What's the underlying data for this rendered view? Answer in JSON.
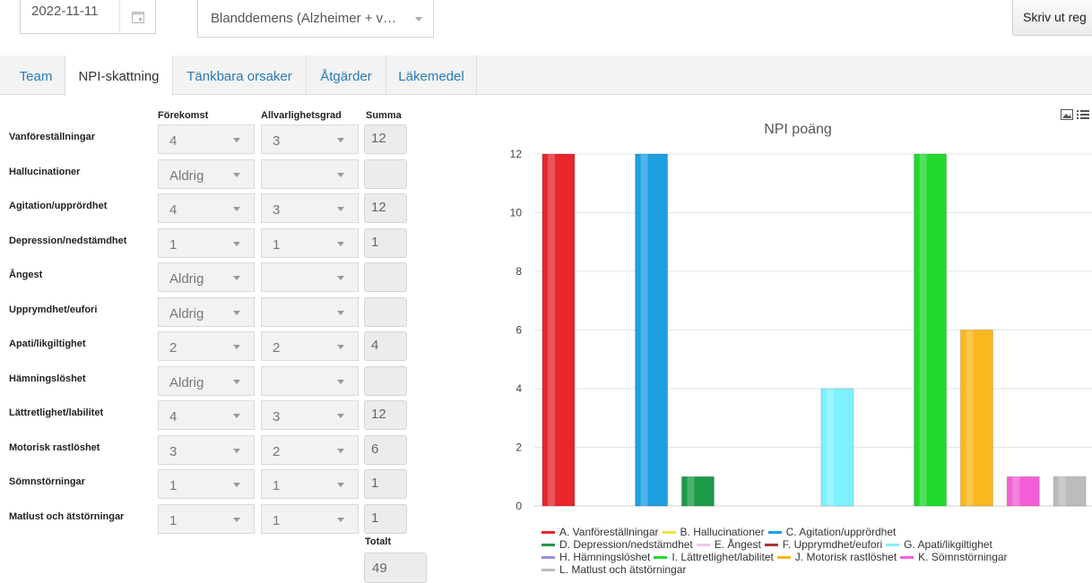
{
  "header": {
    "date_value": "2022-11-11",
    "diagnosis_value": "Blanddemens (Alzheimer + v…",
    "print_label": "Skriv ut reg"
  },
  "tabs": [
    {
      "label": "Team",
      "active": false
    },
    {
      "label": "NPI-skattning",
      "active": true
    },
    {
      "label": "Tänkbara orsaker",
      "active": false
    },
    {
      "label": "Åtgärder",
      "active": false
    },
    {
      "label": "Läkemedel",
      "active": false
    }
  ],
  "grid": {
    "col_frequency": "Förekomst",
    "col_severity": "Allvarlighetsgrad",
    "col_sum": "Summa",
    "total_label": "Totalt",
    "total_value": "49",
    "rows": [
      {
        "label": "Vanföreställningar",
        "frequency": "4",
        "severity": "3",
        "sum": "12"
      },
      {
        "label": "Hallucinationer",
        "frequency": "Aldrig",
        "severity": "",
        "sum": ""
      },
      {
        "label": "Agitation/upprördhet",
        "frequency": "4",
        "severity": "3",
        "sum": "12"
      },
      {
        "label": "Depression/nedstämdhet",
        "frequency": "1",
        "severity": "1",
        "sum": "1"
      },
      {
        "label": "Ångest",
        "frequency": "Aldrig",
        "severity": "",
        "sum": ""
      },
      {
        "label": "Upprymdhet/eufori",
        "frequency": "Aldrig",
        "severity": "",
        "sum": ""
      },
      {
        "label": "Apati/likgiltighet",
        "frequency": "2",
        "severity": "2",
        "sum": "4"
      },
      {
        "label": "Hämningslöshet",
        "frequency": "Aldrig",
        "severity": "",
        "sum": ""
      },
      {
        "label": "Lättretlighet/labilitet",
        "frequency": "4",
        "severity": "3",
        "sum": "12"
      },
      {
        "label": "Motorisk rastlöshet",
        "frequency": "3",
        "severity": "2",
        "sum": "6"
      },
      {
        "label": "Sömnstörningar",
        "frequency": "1",
        "severity": "1",
        "sum": "1"
      },
      {
        "label": "Matlust och ätstörningar",
        "frequency": "1",
        "severity": "1",
        "sum": "1"
      }
    ]
  },
  "chart_data": {
    "type": "bar",
    "title": "NPI poäng",
    "ylim": [
      0,
      12
    ],
    "yticks": [
      0,
      2,
      4,
      6,
      8,
      10,
      12
    ],
    "grid": true,
    "legend_placement": "bottom",
    "series": [
      {
        "name": "A. Vanföreställningar",
        "value": 12,
        "color": "#e8262b"
      },
      {
        "name": "B. Hallucinationer",
        "value": 0,
        "color": "#f5e342"
      },
      {
        "name": "C. Agitation/upprördhet",
        "value": 12,
        "color": "#1ea0e0"
      },
      {
        "name": "D. Depression/nedstämdhet",
        "value": 1,
        "color": "#1c9a48"
      },
      {
        "name": "E. Ångest",
        "value": 0,
        "color": "#f6c2ef"
      },
      {
        "name": "F. Upprymdhet/eufori",
        "value": 0,
        "color": "#a83232"
      },
      {
        "name": "G. Apati/likgiltighet",
        "value": 4,
        "color": "#7ff0ff"
      },
      {
        "name": "H. Hämningslöshet",
        "value": 0,
        "color": "#9b8ee0"
      },
      {
        "name": "I. Lättretlighet/labilitet",
        "value": 12,
        "color": "#21d82d"
      },
      {
        "name": "J. Motorisk rastlöshet",
        "value": 6,
        "color": "#f9b81c"
      },
      {
        "name": "K. Sömnstörningar",
        "value": 1,
        "color": "#f25fd6"
      },
      {
        "name": "L. Matlust och ätstörningar",
        "value": 1,
        "color": "#bcbcbc"
      }
    ]
  }
}
